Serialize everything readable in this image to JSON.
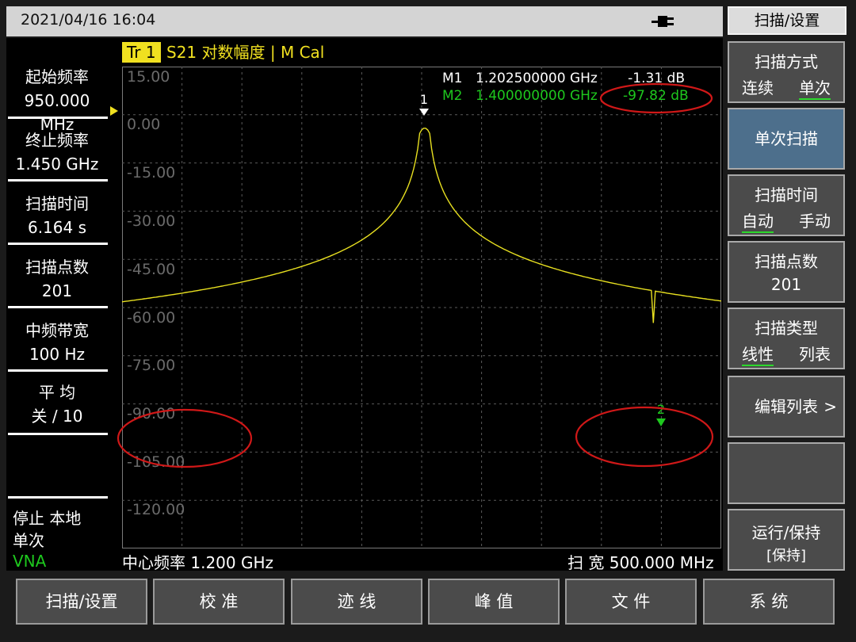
{
  "header": {
    "datetime": "2021/04/16 16:04"
  },
  "trace": {
    "label": "Tr 1",
    "description": "S21 对数幅度 | M Cal"
  },
  "left_panel": [
    {
      "label": "起始频率",
      "value": "950.000 MHz"
    },
    {
      "label": "终止频率",
      "value": "1.450 GHz"
    },
    {
      "label": "扫描时间",
      "value": "6.164 s"
    },
    {
      "label": "扫描点数",
      "value": "201"
    },
    {
      "label": "中频带宽",
      "value": "100 Hz"
    },
    {
      "label": "平 均",
      "value": "关 / 10"
    }
  ],
  "status": {
    "line1": "停止  本地",
    "line2": "单次",
    "line3": "VNA"
  },
  "plot": {
    "y_ticks": [
      "15.00",
      "0.00",
      "-15.00",
      "-30.00",
      "-45.00",
      "-60.00",
      "-75.00",
      "-90.00",
      "-105.00",
      "-120.00"
    ],
    "center_freq": "中心频率  1.200 GHz",
    "span": "扫 宽  500.000 MHz",
    "markers": [
      {
        "name": "M1",
        "freq": "1.202500000 GHz",
        "value": "-1.31 dB",
        "color": "#ffffff"
      },
      {
        "name": "M2",
        "freq": "1.400000000 GHz",
        "value": "-97.82 dB",
        "color": "#1ec81e"
      }
    ],
    "marker_tags": [
      "1",
      "2"
    ],
    "trace_color": "#e8e020",
    "highlight_color": "#d01818"
  },
  "softkeys": {
    "header": "扫描/设置",
    "sweep_mode": {
      "label": "扫描方式",
      "opt1": "连续",
      "opt2": "单次"
    },
    "single_sweep": "单次扫描",
    "sweep_time": {
      "label": "扫描时间",
      "opt1": "自动",
      "opt2": "手动"
    },
    "sweep_points": {
      "label": "扫描点数",
      "value": "201"
    },
    "sweep_type": {
      "label": "扫描类型",
      "opt1": "线性",
      "opt2": "列表"
    },
    "edit_list": "编辑列表",
    "edit_list_arrow": ">",
    "run_hold": {
      "label": "运行/保持",
      "value": "[保持]"
    }
  },
  "bottom_menu": [
    "扫描/设置",
    "校 准",
    "迹 线",
    "峰 值",
    "文 件",
    "系 统"
  ]
}
